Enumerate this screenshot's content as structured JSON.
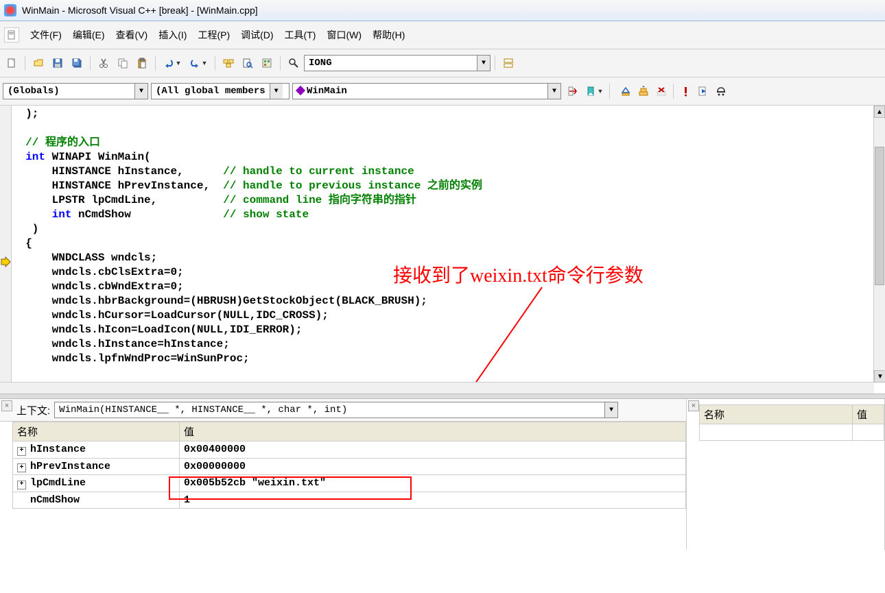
{
  "window": {
    "title": "WinMain - Microsoft Visual C++ [break] - [WinMain.cpp]"
  },
  "menu": {
    "file": "文件(F)",
    "edit": "编辑(E)",
    "view": "查看(V)",
    "insert": "插入(I)",
    "project": "工程(P)",
    "debug": "调试(D)",
    "tools": "工具(T)",
    "window": "窗口(W)",
    "help": "帮助(H)"
  },
  "toolbar1": {
    "search_value": "IONG"
  },
  "toolbar2": {
    "scope": "(Globals)",
    "members": "(All global members",
    "function": "WinMain"
  },
  "code": {
    "l1": "  );",
    "l2": "",
    "l3": "  // 程序的入口",
    "l4_a": "  int",
    "l4_b": " WINAPI WinMain(",
    "l5_a": "      HINSTANCE hInstance,      ",
    "l5_b": "// handle to current instance",
    "l6_a": "      HINSTANCE hPrevInstance,  ",
    "l6_b": "// handle to previous instance 之前的实例",
    "l7_a": "      LPSTR lpCmdLine,          ",
    "l7_b": "// command line 指向字符串的指针",
    "l8_a": "      int",
    "l8_b": " nCmdShow              ",
    "l8_c": "// show state",
    "l9": "   )",
    "l10": "  {",
    "l11": "      WNDCLASS wndcls;",
    "l12": "      wndcls.cbClsExtra=0;",
    "l13": "      wndcls.cbWndExtra=0;",
    "l14": "      wndcls.hbrBackground=(HBRUSH)GetStockObject(BLACK_BRUSH);",
    "l15": "      wndcls.hCursor=LoadCursor(NULL,IDC_CROSS);",
    "l16": "      wndcls.hIcon=LoadIcon(NULL,IDI_ERROR);",
    "l17": "      wndcls.hInstance=hInstance;",
    "l18": "      wndcls.lpfnWndProc=WinSunProc;"
  },
  "annotation": "接收到了weixin.txt命令行参数",
  "watch": {
    "context_label": "上下文:",
    "context_value": "WinMain(HINSTANCE__ *, HINSTANCE__ *, char *, int)",
    "col_name": "名称",
    "col_value": "值",
    "rows": [
      {
        "name": "hInstance",
        "value": "0x00400000",
        "expand": true
      },
      {
        "name": "hPrevInstance",
        "value": "0x00000000",
        "expand": true
      },
      {
        "name": "lpCmdLine",
        "value": "0x005b52cb \"weixin.txt\"",
        "expand": true
      },
      {
        "name": "nCmdShow",
        "value": "1",
        "expand": false
      }
    ]
  },
  "right_panel": {
    "col_name": "名称",
    "col_value": "值"
  }
}
